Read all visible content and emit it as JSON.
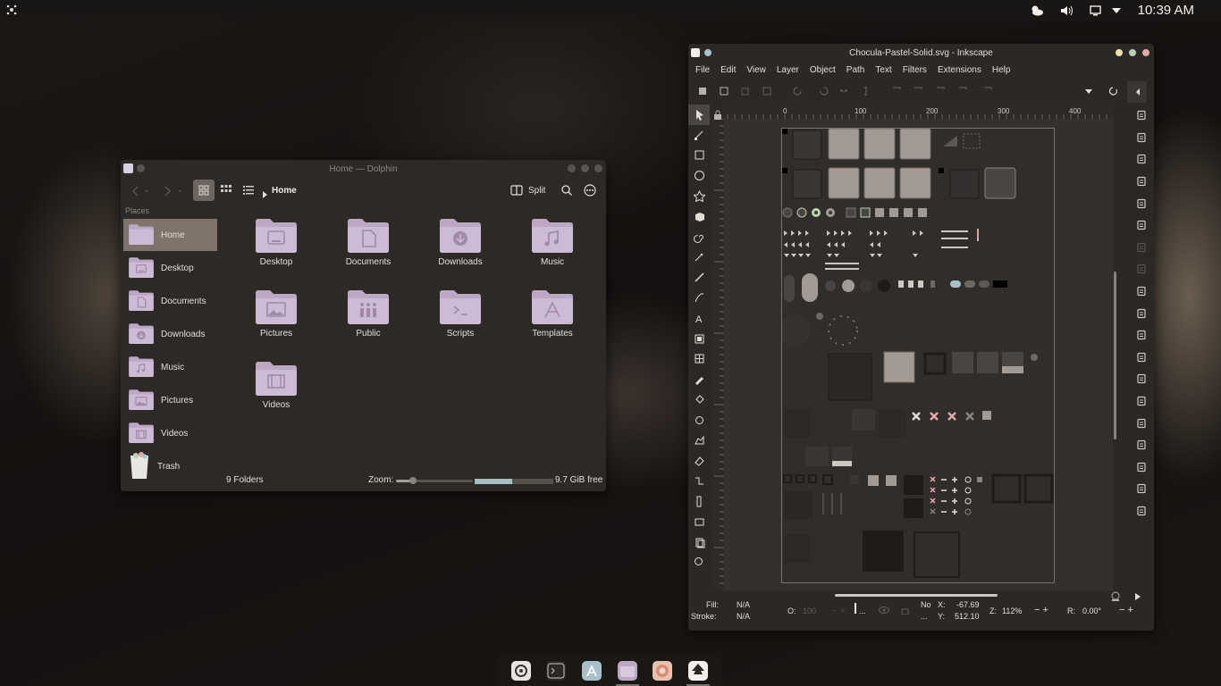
{
  "topbar": {
    "clock": "10:39 AM"
  },
  "dolphin": {
    "title": "Home — Dolphin",
    "breadcrumb": "Home",
    "split_label": "Split",
    "places_header": "Places",
    "places": [
      "Home",
      "Desktop",
      "Documents",
      "Downloads",
      "Music",
      "Pictures",
      "Videos",
      "Trash"
    ],
    "folders": [
      "Desktop",
      "Documents",
      "Downloads",
      "Music",
      "Pictures",
      "Public",
      "Scripts",
      "Templates",
      "Videos"
    ],
    "status_count": "9 Folders",
    "zoom_label": "Zoom:",
    "zoom_level": 0.22,
    "free_space": "9.7 GiB free",
    "disk_used": 0.48,
    "accent": "#c7b3cf",
    "folder_color": "#bca8c4"
  },
  "inkscape": {
    "title": "Chocula-Pastel-Solid.svg - Inkscape",
    "menu": [
      "File",
      "Edit",
      "View",
      "Layer",
      "Object",
      "Path",
      "Text",
      "Filters",
      "Extensions",
      "Help"
    ],
    "ruler_ticks": [
      "0",
      "100",
      "200",
      "300",
      "400"
    ],
    "status": {
      "fill_label": "Fill:",
      "fill_value": "N/A",
      "stroke_label": "Stroke:",
      "stroke_value": "N/A",
      "opacity_label": "O:",
      "opacity_value": "100",
      "layer_value": "...",
      "no_label": "No",
      "x_label": "X:",
      "x_value": "-67.69",
      "y_label": "Y:",
      "y_value": "512.10",
      "zoom_label": "Z:",
      "zoom_value": "112%",
      "rotate_label": "R:",
      "rotate_value": "0.00°"
    }
  },
  "dock": [
    "settings",
    "terminal",
    "appstore",
    "files",
    "firefox",
    "inkscape"
  ]
}
